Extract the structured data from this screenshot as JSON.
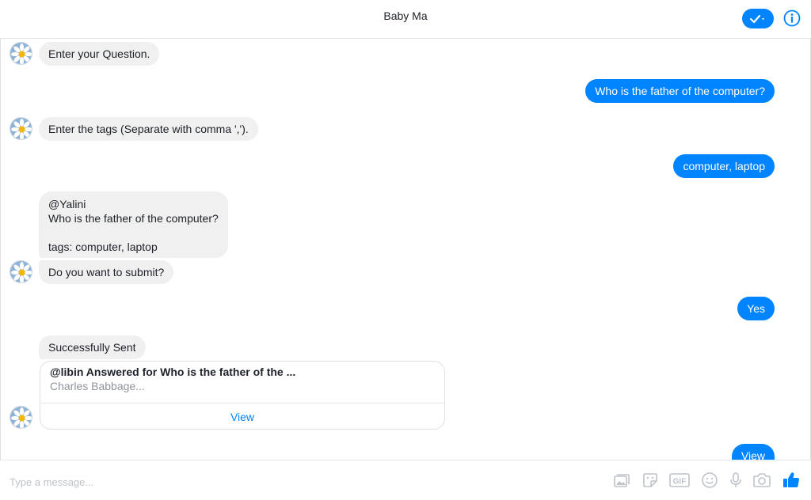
{
  "header": {
    "title": "Baby Ma"
  },
  "messages": [
    {
      "text": "Enter your Question."
    },
    {
      "text": "Who is the father of the computer?"
    },
    {
      "text": "Enter the tags (Separate with comma ',')."
    },
    {
      "text": "computer, laptop"
    },
    {
      "text": "@Yalini\nWho is the father of the computer?\n\ntags: computer, laptop"
    },
    {
      "text": "Do you want to submit?"
    },
    {
      "text": "Yes"
    },
    {
      "text": "Successfully Sent"
    },
    {
      "text": "View"
    }
  ],
  "card": {
    "title": "@libin Answered for Who is the father of the ...",
    "subtitle": "Charles Babbage...",
    "button": "View"
  },
  "composer": {
    "placeholder": "Type a message...",
    "tools": [
      "image-icon",
      "sticker-icon",
      "gif-icon",
      "emoji-icon",
      "microphone-icon",
      "camera-icon",
      "like-icon"
    ]
  },
  "colors": {
    "accent": "#0084ff",
    "incoming": "#f1f0f0"
  }
}
